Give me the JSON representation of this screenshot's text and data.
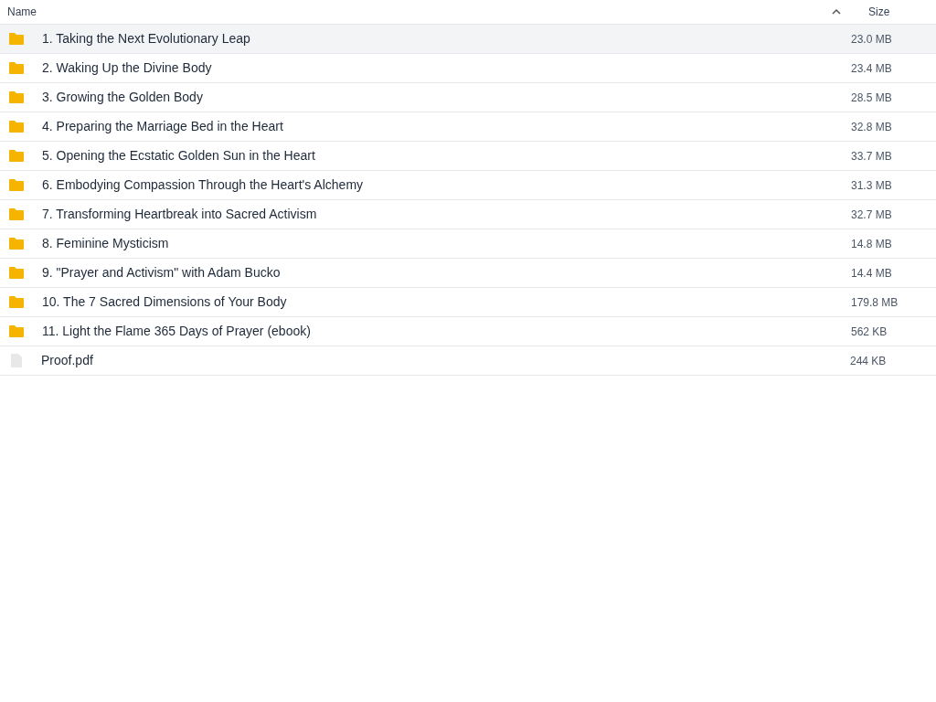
{
  "columns": [
    "Name",
    "Size"
  ],
  "rows": [
    {
      "kind": "folder",
      "name": "1. Taking the Next Evolutionary Leap",
      "size": "23.0 MB",
      "selected": true
    },
    {
      "kind": "folder",
      "name": "2. Waking Up the Divine Body",
      "size": "23.4 MB",
      "selected": false
    },
    {
      "kind": "folder",
      "name": "3. Growing the Golden Body",
      "size": "28.5 MB",
      "selected": false
    },
    {
      "kind": "folder",
      "name": "4. Preparing the Marriage Bed in the Heart",
      "size": "32.8 MB",
      "selected": false
    },
    {
      "kind": "folder",
      "name": "5. Opening the Ecstatic Golden Sun in the Heart",
      "size": "33.7 MB",
      "selected": false
    },
    {
      "kind": "folder",
      "name": "6. Embodying Compassion Through the Heart's Alchemy",
      "size": "31.3 MB",
      "selected": false
    },
    {
      "kind": "folder",
      "name": "7. Transforming Heartbreak into Sacred Activism",
      "size": "32.7 MB",
      "selected": false
    },
    {
      "kind": "folder",
      "name": "8. Feminine Mysticism",
      "size": "14.8 MB",
      "selected": false
    },
    {
      "kind": "folder",
      "name": "9. \"Prayer and Activism\" with Adam Bucko",
      "size": "14.4 MB",
      "selected": false
    },
    {
      "kind": "folder",
      "name": "10. The 7 Sacred Dimensions of Your Body",
      "size": "179.8 MB",
      "selected": false
    },
    {
      "kind": "folder",
      "name": "11. Light the Flame 365 Days of Prayer (ebook)",
      "size": "562 KB",
      "selected": false
    },
    {
      "kind": "file",
      "name": "Proof.pdf",
      "size": "244 KB",
      "selected": false
    }
  ]
}
